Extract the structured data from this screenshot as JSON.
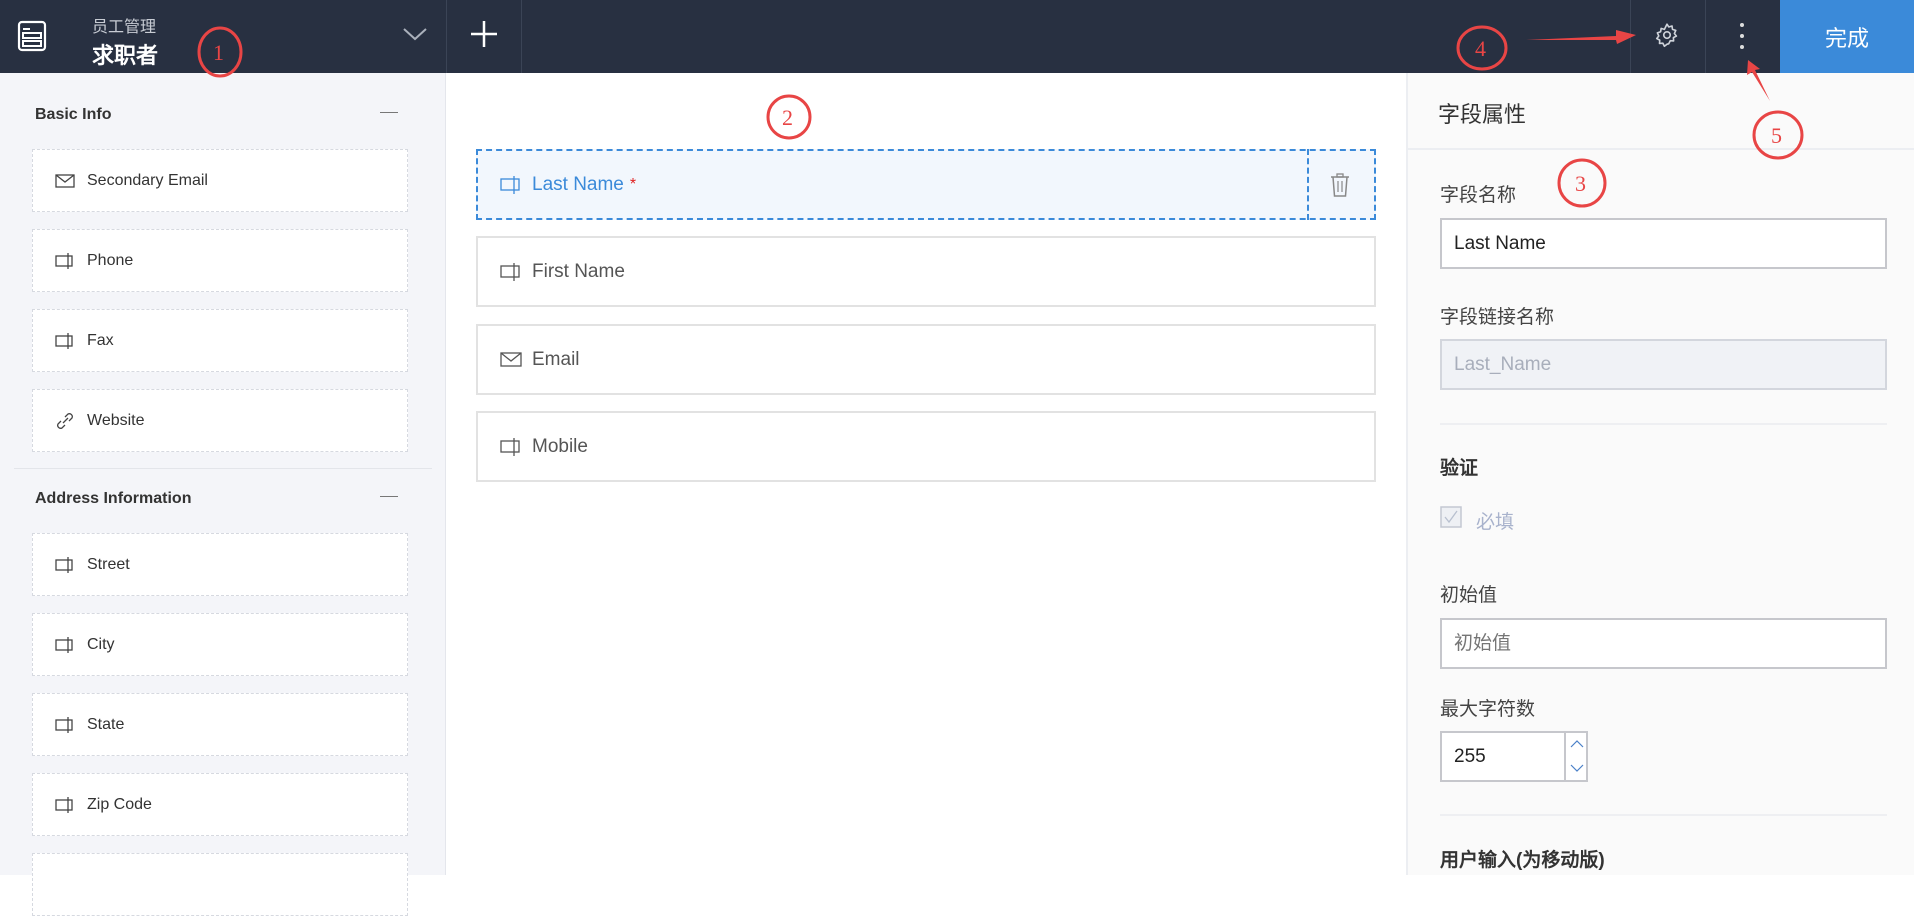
{
  "header": {
    "app_name": "员工管理",
    "form_name": "求职者",
    "done_label": "完成"
  },
  "sidebar": {
    "sections": [
      {
        "title": "Basic Info",
        "items": [
          {
            "label": "Secondary Email",
            "icon": "mail-icon"
          },
          {
            "label": "Phone",
            "icon": "text-field-icon"
          },
          {
            "label": "Fax",
            "icon": "text-field-icon"
          },
          {
            "label": "Website",
            "icon": "link-icon"
          }
        ]
      },
      {
        "title": "Address Information",
        "items": [
          {
            "label": "Street",
            "icon": "text-field-icon"
          },
          {
            "label": "City",
            "icon": "text-field-icon"
          },
          {
            "label": "State",
            "icon": "text-field-icon"
          },
          {
            "label": "Zip Code",
            "icon": "text-field-icon"
          }
        ]
      }
    ]
  },
  "form": {
    "fields": [
      {
        "label": "Last Name",
        "required_mark": "*",
        "selected": true,
        "icon": "text-field-icon"
      },
      {
        "label": "First Name",
        "icon": "text-field-icon"
      },
      {
        "label": "Email",
        "icon": "mail-icon"
      },
      {
        "label": "Mobile",
        "icon": "text-field-icon"
      }
    ]
  },
  "properties": {
    "title": "字段属性",
    "field_name_label": "字段名称",
    "field_name_value": "Last Name",
    "link_name_label": "字段链接名称",
    "link_name_value": "Last_Name",
    "validation_label": "验证",
    "required_label": "必填",
    "required_checked": true,
    "initial_value_label": "初始值",
    "initial_value_placeholder": "初始值",
    "max_chars_label": "最大字符数",
    "max_chars_value": "255",
    "user_input_label": "用户输入(为移动版)"
  },
  "annotations": [
    "1",
    "2",
    "3",
    "4",
    "5"
  ],
  "colors": {
    "topbar": "#283041",
    "accent": "#3b8ad9",
    "annotation": "#e84545"
  }
}
